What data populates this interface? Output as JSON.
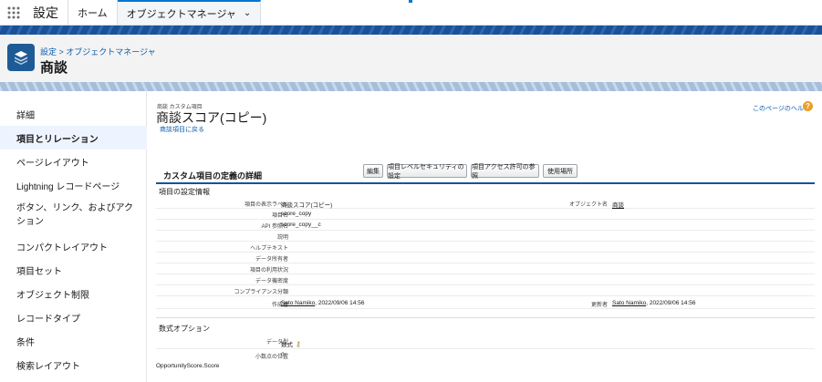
{
  "topnav": {
    "app_name": "設定",
    "tabs": [
      {
        "label": "ホーム"
      },
      {
        "label": "オブジェクトマネージャ"
      }
    ]
  },
  "header": {
    "breadcrumb": "設定 > オブジェクトマネージャ",
    "title": "商談"
  },
  "sidebar": {
    "items": [
      {
        "label": "詳細"
      },
      {
        "label": "項目とリレーション"
      },
      {
        "label": "ページレイアウト"
      },
      {
        "label": "Lightning レコードページ"
      },
      {
        "label": "ボタン、リンク、およびアクション"
      },
      {
        "label": "コンパクトレイアウト"
      },
      {
        "label": "項目セット"
      },
      {
        "label": "オブジェクト制限"
      },
      {
        "label": "レコードタイプ"
      },
      {
        "label": "条件"
      },
      {
        "label": "検索レイアウト"
      }
    ]
  },
  "main": {
    "subtitle": "商談 カスタム項目",
    "title": "商談スコア(コピー)",
    "back_link": "商談項目に戻る",
    "help_link": "このページのヘルプ",
    "section_title": "カスタム項目の定義の詳細",
    "buttons": {
      "edit": "編集",
      "field_security": "項目レベルセキュリティの設定",
      "field_access": "項目アクセス許可の参照",
      "where_used": "使用場所"
    },
    "info_title": "項目の設定情報",
    "rows": [
      {
        "label": "項目の表示ラベル",
        "value": "商談スコア(コピー)",
        "label2": "オブジェクト名",
        "value2": "商談"
      },
      {
        "label": "項目名",
        "value": "score_copy"
      },
      {
        "label": "API 参照名",
        "value": "score_copy__c"
      },
      {
        "label": "説明",
        "value": ""
      },
      {
        "label": "ヘルプテキスト",
        "value": ""
      },
      {
        "label": "データ所有者",
        "value": ""
      },
      {
        "label": "項目の利用状況",
        "value": ""
      },
      {
        "label": "データ機密度",
        "value": ""
      },
      {
        "label": "コンプライアンス分類",
        "value": ""
      },
      {
        "label": "作成者",
        "value": "Sato Namiko",
        "date": ", 2022/09/06 14:56",
        "label2": "更新者",
        "value2": "Sato Namiko",
        "date2": ", 2022/09/06 14:56"
      }
    ],
    "formula_title": "数式オプション",
    "formula_rows": [
      {
        "label": "データ型",
        "value": "数式"
      },
      {
        "label": "小数点の位置",
        "value": "0"
      }
    ],
    "formula_text": "OpportunityScore.Score"
  }
}
